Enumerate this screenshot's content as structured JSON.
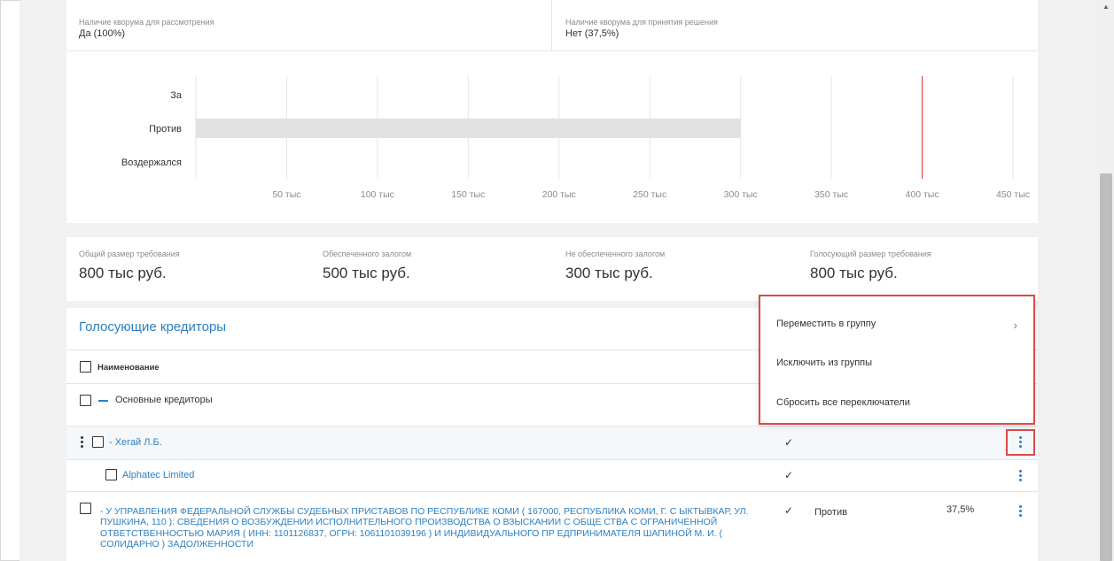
{
  "quorum": {
    "consideration_label": "Наличие кворума для рассмотрения",
    "consideration_value": "Да (100%)",
    "decision_label": "Наличие кворума для принятия решения",
    "decision_value": "Нет (37,5%)"
  },
  "chart_data": {
    "type": "bar",
    "orientation": "horizontal",
    "categories": [
      "За",
      "Против",
      "Воздержался"
    ],
    "values": [
      0,
      300000,
      0
    ],
    "xlim": [
      0,
      450000
    ],
    "x_ticks": [
      "50 тыс",
      "100 тыс",
      "150 тыс",
      "200 тыс",
      "250 тыс",
      "300 тыс",
      "350 тыс",
      "400 тыс",
      "450 тыс"
    ],
    "x_tick_values": [
      50000,
      100000,
      150000,
      200000,
      250000,
      300000,
      350000,
      400000,
      450000
    ],
    "threshold": 400000,
    "threshold_color": "#e04848",
    "bar_color": "#e2e2e2",
    "grid": true
  },
  "totals": {
    "total_label": "Общий размер требования",
    "total_value": "800 тыс руб.",
    "secured_label": "Обеспеченного залогом",
    "secured_value": "500 тыс руб.",
    "unsecured_label": "Не обеспеченного залогом",
    "unsecured_value": "300 тыс руб.",
    "voting_label": "Голосующий размер требования",
    "voting_value": "800 тыс руб."
  },
  "creditors": {
    "title": "Голосующие кредиторы",
    "column_name": "Наименование",
    "group_label": "Основные кредиторы",
    "rows": [
      {
        "name": "- Хегай Л.Б.",
        "check": "✓"
      },
      {
        "name": "Alphatec Limited",
        "check": "✓"
      },
      {
        "name": "- У УПРАВЛЕНИЯ ФЕДЕРАЛЬНОЙ СЛУЖБЫ СУДЕБНЫХ ПРИСТАВОВ ПО РЕСПУБЛИКЕ КОМИ ( 167000, РЕСПУБЛИКА КОМИ, Г. С ЫКТЫВКАР, УЛ. ПУШКИНА, 110 ): СВЕДЕНИЯ О ВОЗБУЖДЕНИИ ИСПОЛНИТЕЛЬНОГО ПРОИЗВОДСТВА О ВЗЫСКАНИИ С ОБЩЕ СТВА С ОГРАНИЧЕННОЙ ОТВЕТСТВЕННОСТЬЮ МАРИЯ ( ИНН: 1101126837, ОГРН: 1061101039196 ) И ИНДИВИДУАЛЬНОГО ПР ЕДПРИНИМАТЕЛЯ ШАПИНОЙ М. И. ( СОЛИДАРНО ) ЗАДОЛЖЕННОСТИ",
        "check": "✓",
        "vote": "Против",
        "percent": "37,5%"
      }
    ]
  },
  "menu": {
    "move_to_group": "Переместить в группу",
    "exclude_from_group": "Исключить из группы",
    "reset_switches": "Сбросить все переключатели"
  }
}
